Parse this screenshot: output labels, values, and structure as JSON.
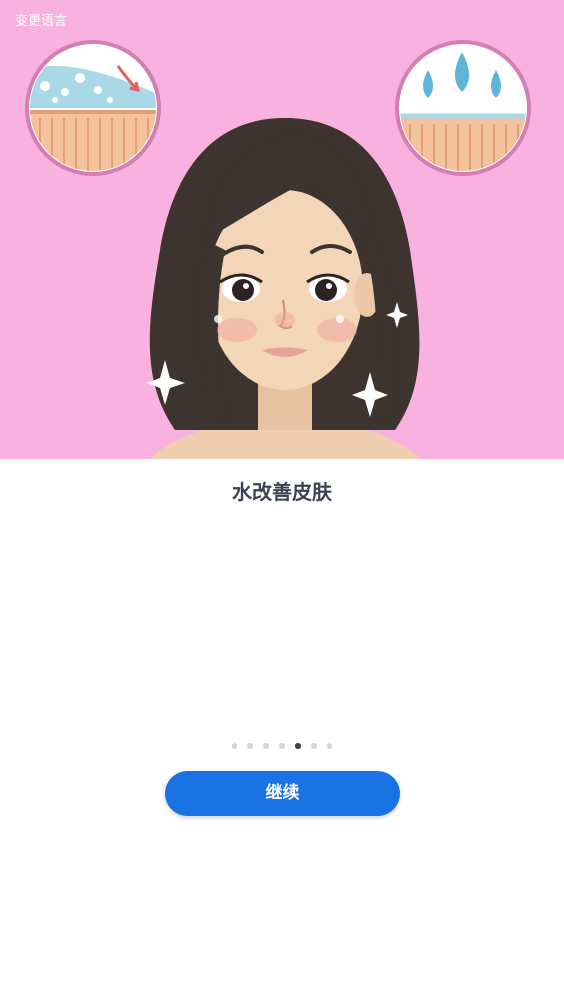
{
  "header": {
    "language_link": "变更语言"
  },
  "hero": {
    "background_color": "#f9b1df",
    "illustration": "cartoon-woman-skin-hydration",
    "left_badge_icon": "skin-bubbles-icon",
    "right_badge_icon": "water-drops-icon"
  },
  "slide": {
    "title": "水改善皮肤"
  },
  "pager": {
    "total": 7,
    "active_index": 4
  },
  "actions": {
    "continue_label": "继续",
    "continue_color": "#1a73e3"
  }
}
